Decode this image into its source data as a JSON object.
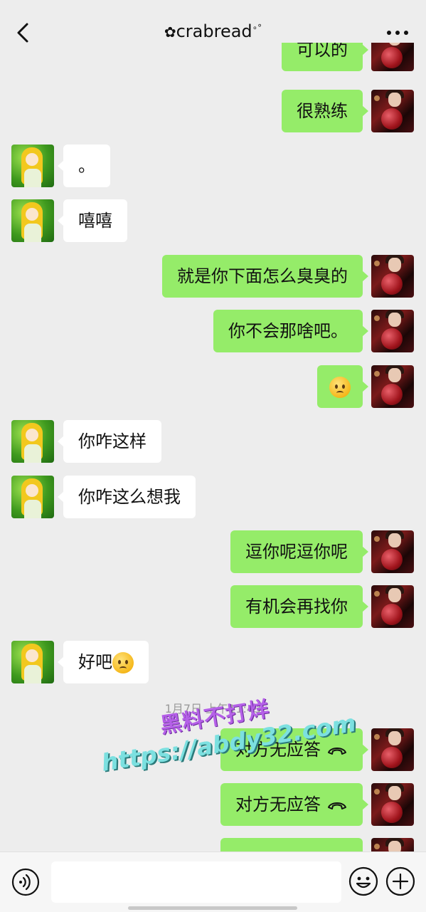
{
  "header": {
    "title": "crabread",
    "title_prefix_glyph": "✿",
    "title_suffix": "∘°",
    "back_icon": "chevron-left-icon",
    "more_icon": "more-horizontal-icon"
  },
  "messages": [
    {
      "side": "right",
      "text": "可以的"
    },
    {
      "side": "right",
      "text": "很熟练"
    },
    {
      "side": "left",
      "text": "。"
    },
    {
      "side": "left",
      "text": "嘻嘻"
    },
    {
      "side": "right",
      "text": "就是你下面怎么臭臭的"
    },
    {
      "side": "right",
      "text": "你不会那啥吧。"
    },
    {
      "side": "right",
      "emoji": "worried-face-emoji"
    },
    {
      "side": "left",
      "text": "你咋这样"
    },
    {
      "side": "left",
      "text": "你咋这么想我"
    },
    {
      "side": "right",
      "text": "逗你呢逗你呢"
    },
    {
      "side": "right",
      "text": "有机会再找你"
    },
    {
      "side": "left",
      "text": "好吧",
      "emoji": "worried-face-emoji"
    },
    {
      "side": "right",
      "text": "对方无应答",
      "icon": "call-declined-icon"
    },
    {
      "side": "right",
      "text": "对方无应答",
      "icon": "call-declined-icon"
    }
  ],
  "timestamp": "1月7日 上午11:43",
  "watermark": {
    "line1": "黑料不打烊",
    "line2": "https://abdy32.com"
  },
  "input": {
    "value": "",
    "placeholder": "",
    "voice_icon": "voice-icon",
    "emoji_icon": "emoji-icon",
    "plus_icon": "plus-icon"
  },
  "colors": {
    "background": "#ededed",
    "bubble_self": "#95ec69",
    "bubble_other": "#ffffff",
    "text": "#111111",
    "timestamp": "#9a9a9a"
  }
}
